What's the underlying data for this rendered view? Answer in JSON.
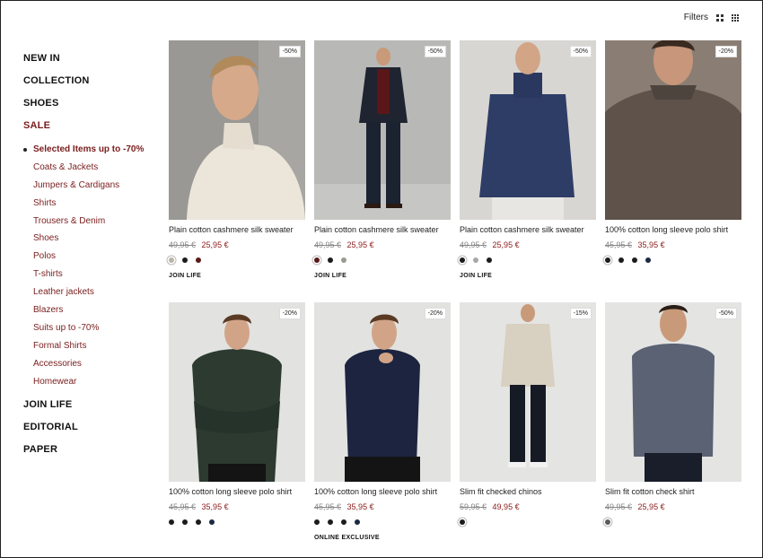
{
  "toolbar": {
    "filters_label": "Filters"
  },
  "sidebar": {
    "main_top": [
      "NEW IN",
      "COLLECTION",
      "SHOES",
      "SALE"
    ],
    "sub": [
      "Selected Items up to -70%",
      "Coats & Jackets",
      "Jumpers & Cardigans",
      "Shirts",
      "Trousers & Denim",
      "Shoes",
      "Polos",
      "T-shirts",
      "Leather jackets",
      "Blazers",
      "Suits up to -70%",
      "Formal Shirts",
      "Accessories",
      "Homewear"
    ],
    "main_bottom": [
      "JOIN LIFE",
      "EDITORIAL",
      "PAPER"
    ]
  },
  "products": [
    {
      "badge": "-50%",
      "name": "Plain cotton cashmere silk sweater",
      "old_price": "49,95 €",
      "price": "25,95 €",
      "swatches": [
        "#b8b4a8",
        "#1c1c1c",
        "#5a1a1a"
      ],
      "tag": "JOIN LIFE"
    },
    {
      "badge": "-50%",
      "name": "Plain cotton cashmere silk sweater",
      "old_price": "49,95 €",
      "price": "25,95 €",
      "swatches": [
        "#5a1a1a",
        "#1c1c1c",
        "#9a9a90"
      ],
      "tag": "JOIN LIFE"
    },
    {
      "badge": "-50%",
      "name": "Plain cotton cashmere silk sweater",
      "old_price": "49,95 €",
      "price": "25,95 €",
      "swatches": [
        "#1c1c1c",
        "#a8a8a8",
        "#1c1c1c"
      ],
      "tag": "JOIN LIFE"
    },
    {
      "badge": "-20%",
      "name": "100% cotton long sleeve polo shirt",
      "old_price": "45,95 €",
      "price": "35,95 €",
      "swatches": [
        "#1c1c1c",
        "#1c1c1c",
        "#1c1c1c",
        "#1a2a44"
      ],
      "tag": ""
    },
    {
      "badge": "-20%",
      "name": "100% cotton long sleeve polo shirt",
      "old_price": "45,95 €",
      "price": "35,95 €",
      "swatches": [
        "#1c1c1c",
        "#1c1c1c",
        "#1c1c1c",
        "#1a2a44"
      ],
      "tag": ""
    },
    {
      "badge": "-20%",
      "name": "100% cotton long sleeve polo shirt",
      "old_price": "45,95 €",
      "price": "35,95 €",
      "swatches": [
        "#1c1c1c",
        "#1c1c1c",
        "#1c1c1c",
        "#1a2a44"
      ],
      "tag": "ONLINE EXCLUSIVE"
    },
    {
      "badge": "-15%",
      "name": "Slim fit checked chinos",
      "old_price": "59,95 €",
      "price": "49,95 €",
      "swatches": [
        "#1c1c1c"
      ],
      "tag": ""
    },
    {
      "badge": "-50%",
      "name": "Slim fit cotton check shirt",
      "old_price": "49,95 €",
      "price": "25,95 €",
      "swatches": [
        "#5a5a60"
      ],
      "tag": ""
    }
  ],
  "colors": {
    "accent": "#7a1d1d",
    "sale_price": "#8b1a1a"
  }
}
